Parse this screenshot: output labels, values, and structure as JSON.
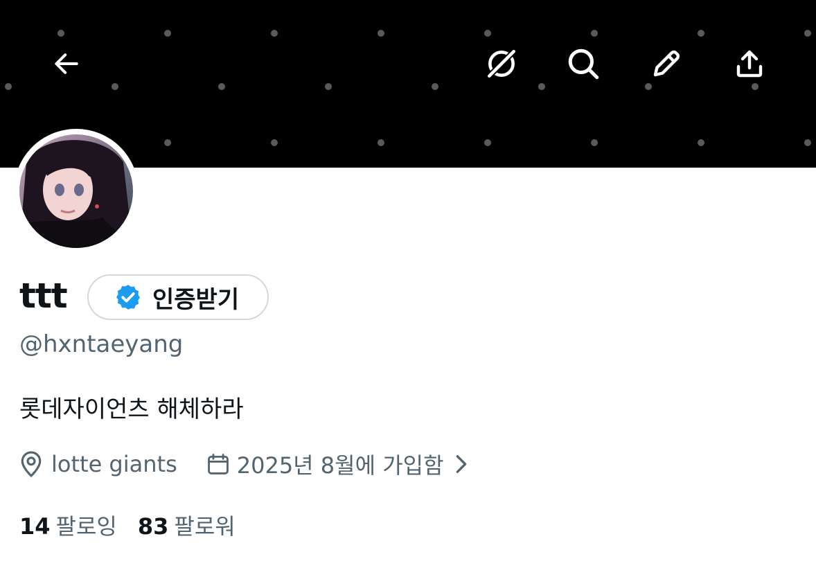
{
  "profile": {
    "display_name": "ttt",
    "verify_button_label": "인증받기",
    "handle": "@hxntaeyang",
    "bio": "롯데자이언츠 해체하라",
    "location": "lotte giants",
    "joined": "2025년 8월에 가입함",
    "following_count": "14",
    "following_label": "팔로잉",
    "followers_count": "83",
    "followers_label": "팔로워"
  },
  "header_icons": {
    "back": "back-arrow-icon",
    "grok": "grok-icon",
    "search": "search-icon",
    "edit": "edit-pencil-icon",
    "share": "share-icon"
  },
  "colors": {
    "banner": "#000000",
    "verified_blue": "#1d9bf0",
    "secondary_text": "#536471",
    "primary_text": "#0f1419",
    "button_border": "#cfd9de"
  }
}
